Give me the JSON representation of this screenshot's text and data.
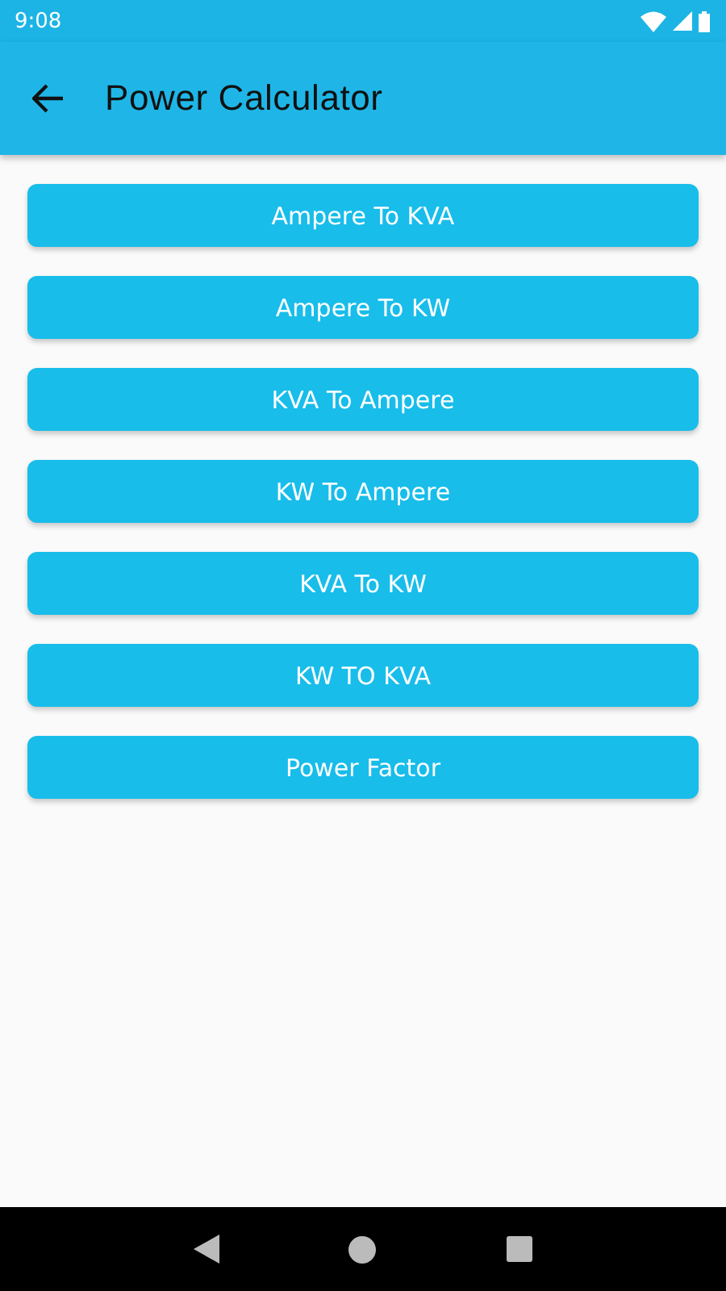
{
  "status_bar": {
    "time": "9:08"
  },
  "app_bar": {
    "title": "Power Calculator"
  },
  "buttons": [
    {
      "label": "Ampere To KVA"
    },
    {
      "label": "Ampere To KW"
    },
    {
      "label": "KVA To Ampere"
    },
    {
      "label": "KW To Ampere"
    },
    {
      "label": "KVA To KW"
    },
    {
      "label": "KW TO KVA"
    },
    {
      "label": "Power Factor"
    }
  ]
}
